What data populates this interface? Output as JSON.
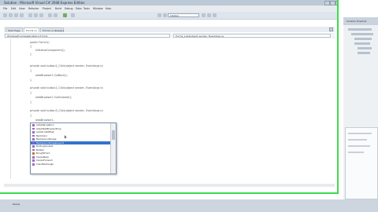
{
  "window": {
    "title": "Solution - Microsoft Visual C# 2008 Express Edition"
  },
  "menu": [
    "File",
    "Edit",
    "View",
    "Refactor",
    "Project",
    "Build",
    "Debug",
    "Data",
    "Tools",
    "Window",
    "Help"
  ],
  "toolbar": {
    "search_value": "sidebar"
  },
  "tabs": [
    {
      "label": "Start Page",
      "active": false
    },
    {
      "label": "Form1.cs",
      "active": true
    },
    {
      "label": "Form1.cs [Design]",
      "active": false
    }
  ],
  "nav": {
    "left": "WindowsFormsApplication1.Form1",
    "right": "Form1_Load(object sender, EventArgs e)"
  },
  "code_lines": [
    "public Form1()",
    "{",
    "InitializeComponent();",
    "}",
    "private void button1_Click(object sender, EventArgs e)",
    "{",
    "webBrowser1.GoBack();",
    "}",
    "private void button2_Click(object sender, EventArgs e)",
    "{",
    "webBrowser1.GoForward();",
    "}",
    "private void button3_Click(object sender, EventArgs e)",
    "{",
    "webBrowser1."
  ],
  "intellisense": {
    "items": [
      "AllowNavigation",
      "AllowWebBrowserDrop",
      "AutoScrollOffset",
      "BackColor",
      "BackgroundImage",
      "BackgroundImageLayout",
      "BindingContext",
      "Bottom",
      "BringToFront",
      "CanGoBack",
      "CanGoForward",
      "ClientRectangle"
    ],
    "selected_index": 5
  },
  "status": {
    "text": "Ready"
  },
  "right_pane": {
    "title": "Solution Explorer"
  }
}
